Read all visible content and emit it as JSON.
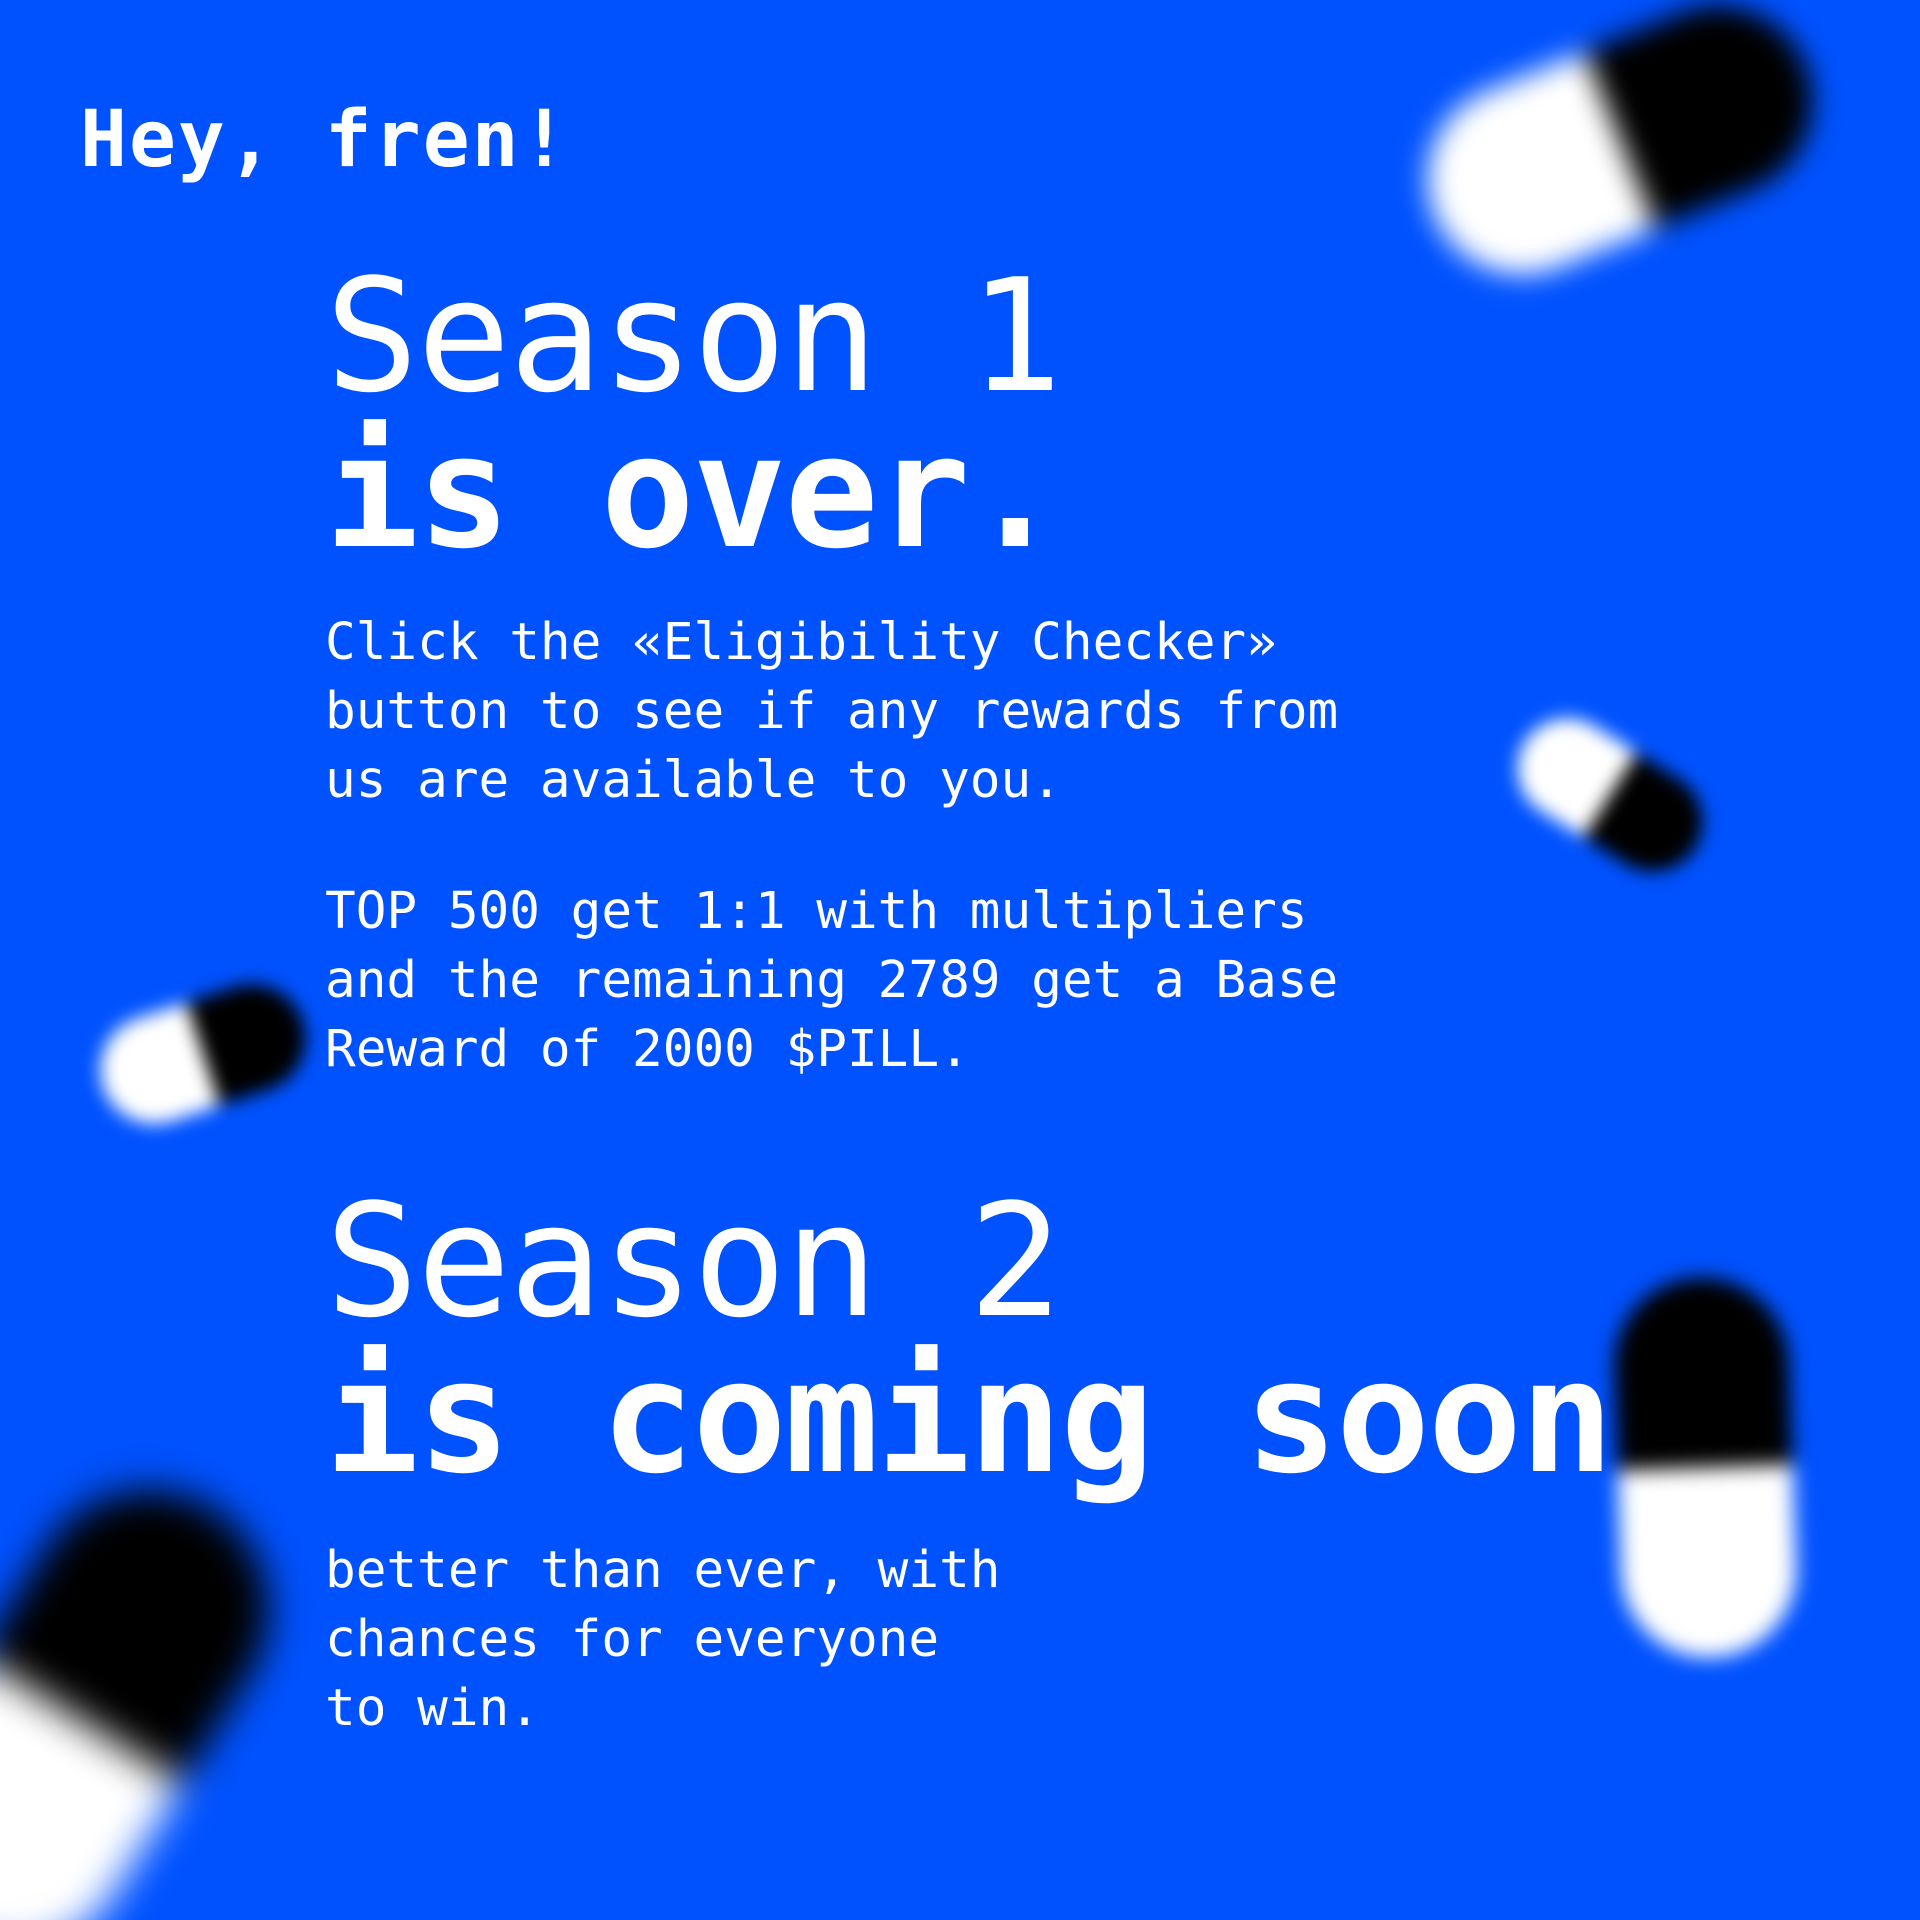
{
  "greeting": "Hey, fren!",
  "season1": {
    "line1": "Season 1",
    "line2": "is over.",
    "paragraph1": "Click the «Eligibility Checker»\nbutton to see if any rewards from\nus are available to you.",
    "paragraph2": "TOP 500 get 1:1 with multipliers\nand the remaining 2789 get a Base\nReward of 2000 $PILL."
  },
  "season2": {
    "line1": "Season 2",
    "line2": "is coming soon",
    "paragraph": "better than ever, with\nchances for everyone\nto win."
  },
  "colors": {
    "background": "#0052ff",
    "text": "#ffffff",
    "pill_dark": "#000000",
    "pill_light": "#ffffff"
  },
  "decorations": [
    "pill-icon",
    "pill-icon",
    "pill-icon",
    "pill-icon",
    "pill-icon"
  ]
}
